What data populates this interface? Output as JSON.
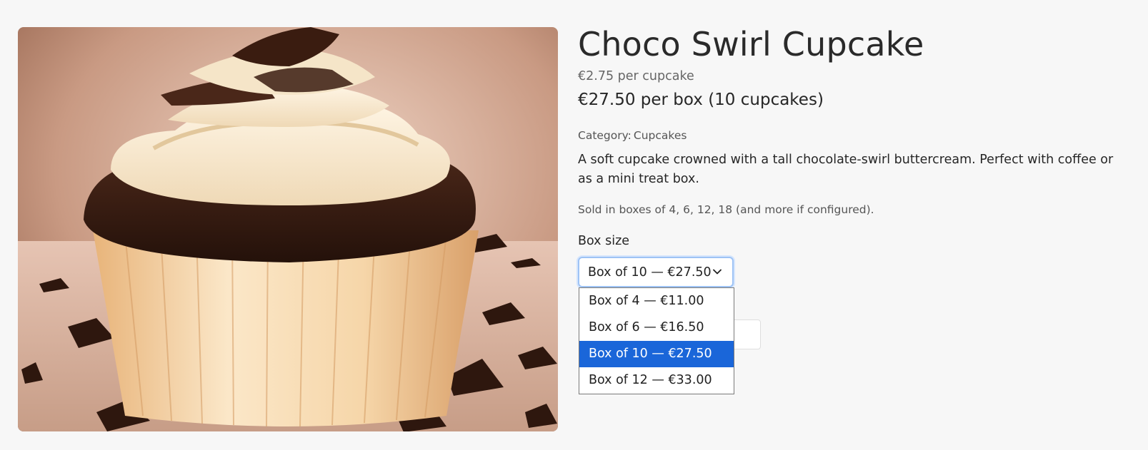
{
  "product": {
    "title": "Choco Swirl Cupcake",
    "unit_price": "€2.75 per cupcake",
    "box_price": "€27.50 per box (10 cupcakes)",
    "category_label": "Category:",
    "category_value": "Cupcakes",
    "description": "A soft cupcake crowned with a tall chocolate-swirl buttercream. Perfect with coffee or as a mini treat box.",
    "sold_note": "Sold in boxes of 4, 6, 12, 18 (and more if configured).",
    "image_icon": "cupcake-photo"
  },
  "box_select": {
    "label": "Box size",
    "selected": "Box of 10 — €27.50",
    "chevron_icon": "chevron-down-icon",
    "options": [
      "Box of 4 — €11.00",
      "Box of 6 — €16.50",
      "Box of 10 — €27.50",
      "Box of 12 — €33.00"
    ],
    "selected_index": 2
  },
  "colors": {
    "background": "#f7f7f7",
    "select_focus": "#9ec3f5",
    "option_highlight": "#1a66d9",
    "chocolate": "#3b1f14",
    "cream": "#f3e6cf"
  }
}
